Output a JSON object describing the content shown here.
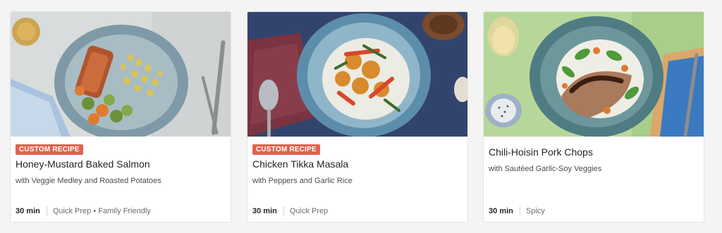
{
  "recipes": [
    {
      "image_alt": "Honey-Mustard Baked Salmon",
      "badge": "CUSTOM RECIPE",
      "title": "Honey-Mustard Baked Salmon",
      "subtitle": "with Veggie Medley and Roasted Potatoes",
      "time": "30 min",
      "tags": "Quick Prep • Family Friendly"
    },
    {
      "image_alt": "Chicken Tikka Masala",
      "badge": "CUSTOM RECIPE",
      "title": "Chicken Tikka Masala",
      "subtitle": "with Peppers and Garlic Rice",
      "time": "30 min",
      "tags": "Quick Prep"
    },
    {
      "image_alt": "Chili-Hoisin Pork Chops",
      "title": "Chili-Hoisin Pork Chops",
      "subtitle": "with Sautéed Garlic-Soy Veggies",
      "time": "30 min",
      "tags": "Spicy"
    }
  ],
  "colors": {
    "badge": "#e0624f",
    "card_background": "#ffffff",
    "page_background": "#f4f4f4"
  }
}
